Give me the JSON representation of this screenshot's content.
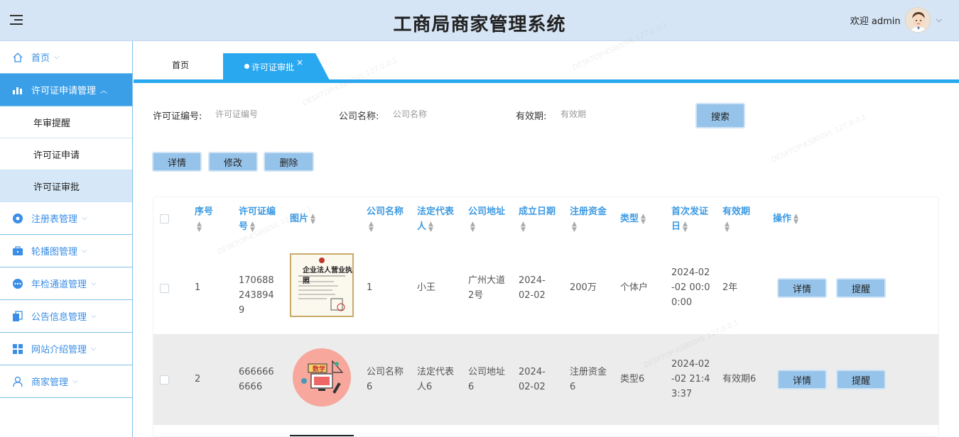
{
  "header": {
    "title": "工商局商家管理系统",
    "welcome": "欢迎 admin"
  },
  "sidebar": {
    "items": [
      {
        "label": "首页",
        "icon": "home-icon"
      },
      {
        "label": "许可证申请管理",
        "icon": "chart-icon",
        "active": true,
        "children": [
          {
            "label": "年审提醒"
          },
          {
            "label": "许可证申请"
          },
          {
            "label": "许可证审批",
            "selected": true
          }
        ]
      },
      {
        "label": "注册表管理",
        "icon": "target-icon"
      },
      {
        "label": "轮播图管理",
        "icon": "briefcase-icon"
      },
      {
        "label": "年检通道管理",
        "icon": "ellipsis-circle-icon"
      },
      {
        "label": "公告信息管理",
        "icon": "copy-icon"
      },
      {
        "label": "网站介绍管理",
        "icon": "grid-icon"
      },
      {
        "label": "商家管理",
        "icon": "user-icon"
      }
    ]
  },
  "tabs": {
    "home": "首页",
    "active": "许可证审批",
    "close": "×"
  },
  "search": {
    "license_no_label": "许可证编号:",
    "license_no_placeholder": "许可证编号",
    "company_label": "公司名称:",
    "company_placeholder": "公司名称",
    "validity_label": "有效期:",
    "validity_placeholder": "有效期",
    "search_button": "搜索"
  },
  "actions": {
    "detail": "详情",
    "edit": "修改",
    "delete": "删除"
  },
  "table": {
    "headers": [
      "序号",
      "许可证编号",
      "图片",
      "公司名称",
      "法定代表人",
      "公司地址",
      "成立日期",
      "注册资金",
      "类型",
      "首次发证日",
      "有效期",
      "操作"
    ],
    "rows": [
      {
        "index": "1",
        "license_no": "1706882438949",
        "image_text": "企业法人营业执照",
        "company": "1",
        "legal_rep": "小王",
        "address": "广州大道2号",
        "founded": "2024-02-02",
        "capital": "200万",
        "type": "个体户",
        "first_issue": "2024-02-02 00:00:00",
        "validity": "2年",
        "btn_detail": "详情",
        "btn_remind": "提醒"
      },
      {
        "index": "2",
        "license_no": "6666666666",
        "image_text": "数学",
        "company": "公司名称6",
        "legal_rep": "法定代表人6",
        "address": "公司地址6",
        "founded": "2024-02-02",
        "capital": "注册资金6",
        "type": "类型6",
        "first_issue": "2024-02-02 21:43:37",
        "validity": "有效期6",
        "btn_detail": "详情",
        "btn_remind": "提醒"
      }
    ]
  },
  "watermark": "DESKTOP-KSB00VL 127.0.0.1"
}
